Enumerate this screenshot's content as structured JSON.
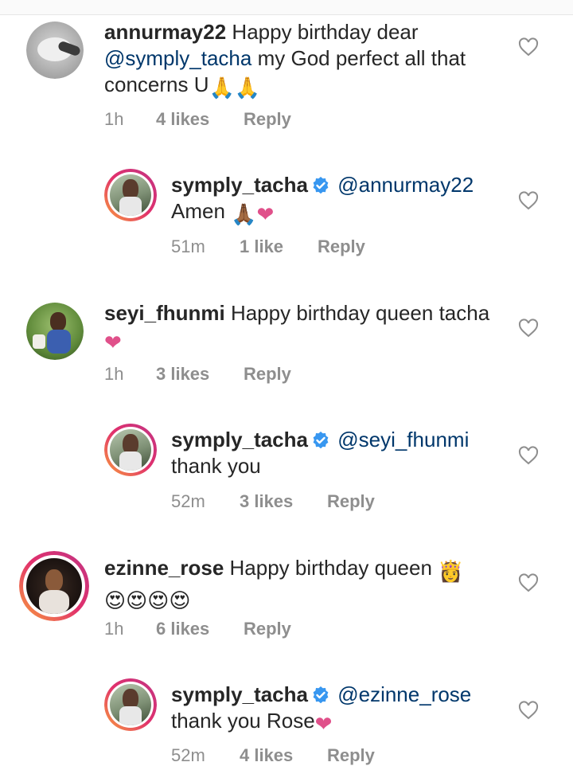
{
  "comments": [
    {
      "username": "annurmay22",
      "text_before": " Happy birthday dear",
      "mention": "@symply_tacha",
      "text_after": "  my God perfect all that concerns U",
      "emoji": "🙏🙏",
      "time": "1h",
      "likes": "4 likes",
      "reply": "Reply"
    },
    {
      "username": "symply_tacha",
      "mention": "@annurmay22",
      "text": "Amen",
      "emoji": "🙏🏾❤",
      "time": "51m",
      "likes": "1 like",
      "reply": "Reply"
    },
    {
      "username": "seyi_fhunmi",
      "text": " Happy birthday queen tacha",
      "emoji": "❤",
      "time": "1h",
      "likes": "3 likes",
      "reply": "Reply"
    },
    {
      "username": "symply_tacha",
      "mention": "@seyi_fhunmi",
      "text": "thank you",
      "time": "52m",
      "likes": "3 likes",
      "reply": "Reply"
    },
    {
      "username": "ezinne_rose",
      "text": " Happy birthday queen",
      "emoji": "👸",
      "emoji2": "😍😍😍😍",
      "time": "1h",
      "likes": "6 likes",
      "reply": "Reply"
    },
    {
      "username": "symply_tacha",
      "mention": "@ezinne_rose",
      "text": "thank you Rose",
      "emoji": "❤",
      "time": "52m",
      "likes": "4 likes",
      "reply": "Reply"
    }
  ],
  "icons": {
    "heart": "heart-outline-icon",
    "verified": "verified-badge-icon"
  },
  "colors": {
    "mention": "#00376b",
    "meta": "#8e8e8e",
    "verified": "#3897f0",
    "story_ring_start": "#f9a03c",
    "story_ring_end": "#c13584"
  }
}
